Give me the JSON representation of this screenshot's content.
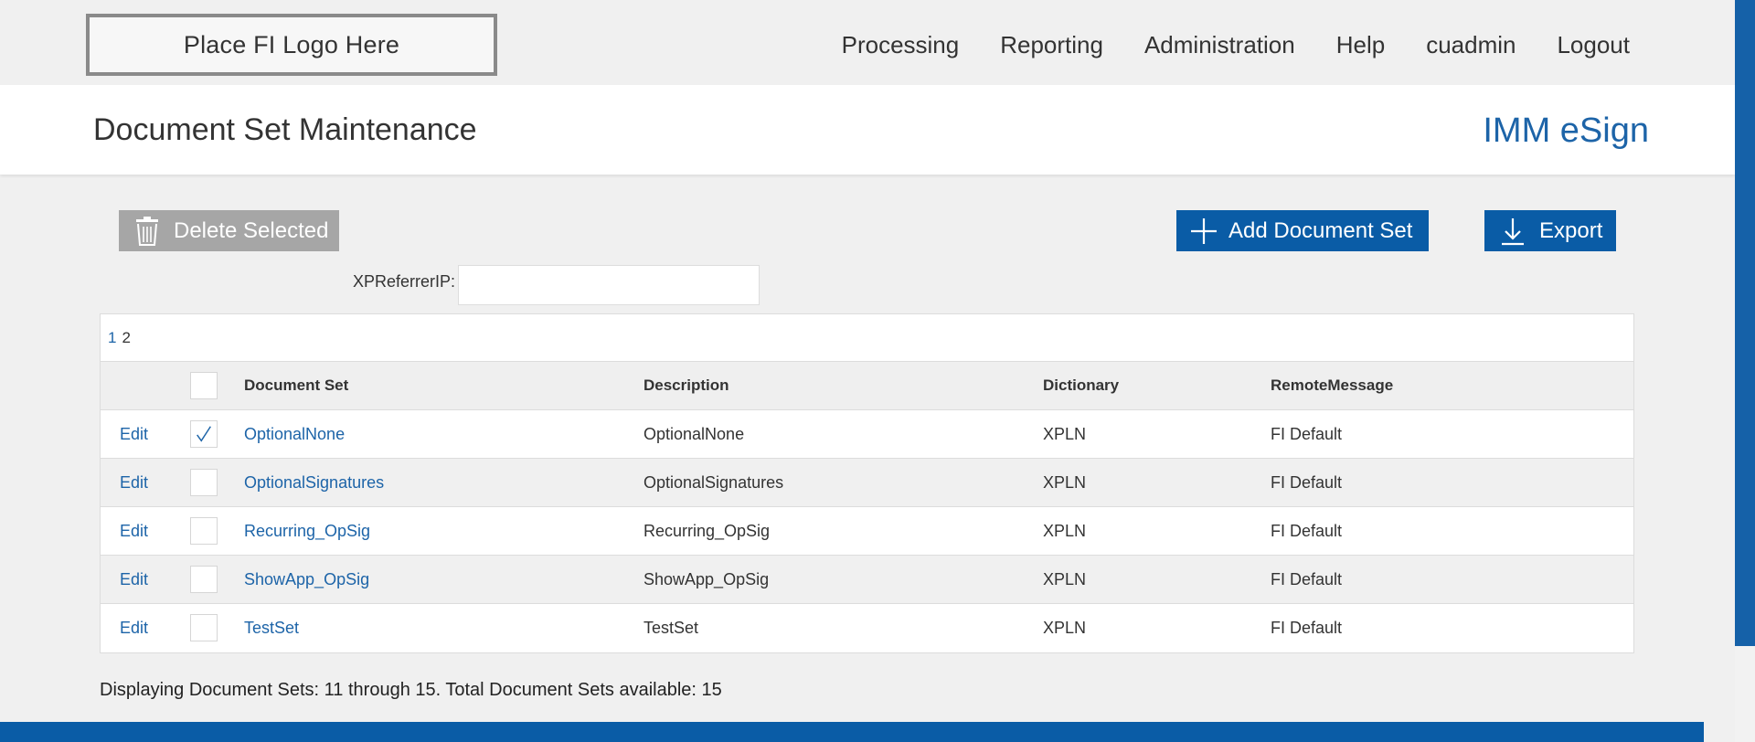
{
  "header": {
    "logo_text": "Place FI Logo Here",
    "nav": [
      "Processing",
      "Reporting",
      "Administration",
      "Help",
      "cuadmin",
      "Logout"
    ]
  },
  "titlebar": {
    "title": "Document Set Maintenance",
    "product": "IMM eSign"
  },
  "toolbar": {
    "delete_label": "Delete Selected",
    "add_label": "Add Document Set",
    "export_label": "Export",
    "delete_icon": "trash-icon",
    "add_icon": "plus-icon",
    "export_icon": "download-icon"
  },
  "filter": {
    "label": "XPReferrerIP:",
    "value": ""
  },
  "pager": {
    "pages": [
      "1",
      "2"
    ],
    "current": "1"
  },
  "table": {
    "columns": [
      "Document Set",
      "Description",
      "Dictionary",
      "RemoteMessage"
    ],
    "edit_label": "Edit",
    "rows": [
      {
        "set": "OptionalNone",
        "description": "OptionalNone",
        "dictionary": "XPLN",
        "remote": "FI Default",
        "checked": true
      },
      {
        "set": "OptionalSignatures",
        "description": "OptionalSignatures",
        "dictionary": "XPLN",
        "remote": "FI Default",
        "checked": false
      },
      {
        "set": "Recurring_OpSig",
        "description": "Recurring_OpSig",
        "dictionary": "XPLN",
        "remote": "FI Default",
        "checked": false
      },
      {
        "set": "ShowApp_OpSig",
        "description": "ShowApp_OpSig",
        "dictionary": "XPLN",
        "remote": "FI Default",
        "checked": false
      },
      {
        "set": "TestSet",
        "description": "TestSet",
        "dictionary": "XPLN",
        "remote": "FI Default",
        "checked": false
      }
    ]
  },
  "status": "Displaying Document Sets: 11 through 15. Total Document Sets available: 15",
  "colors": {
    "accent": "#0a5ca6",
    "link": "#1d64a8",
    "disabled_button": "#a6a6a6"
  }
}
